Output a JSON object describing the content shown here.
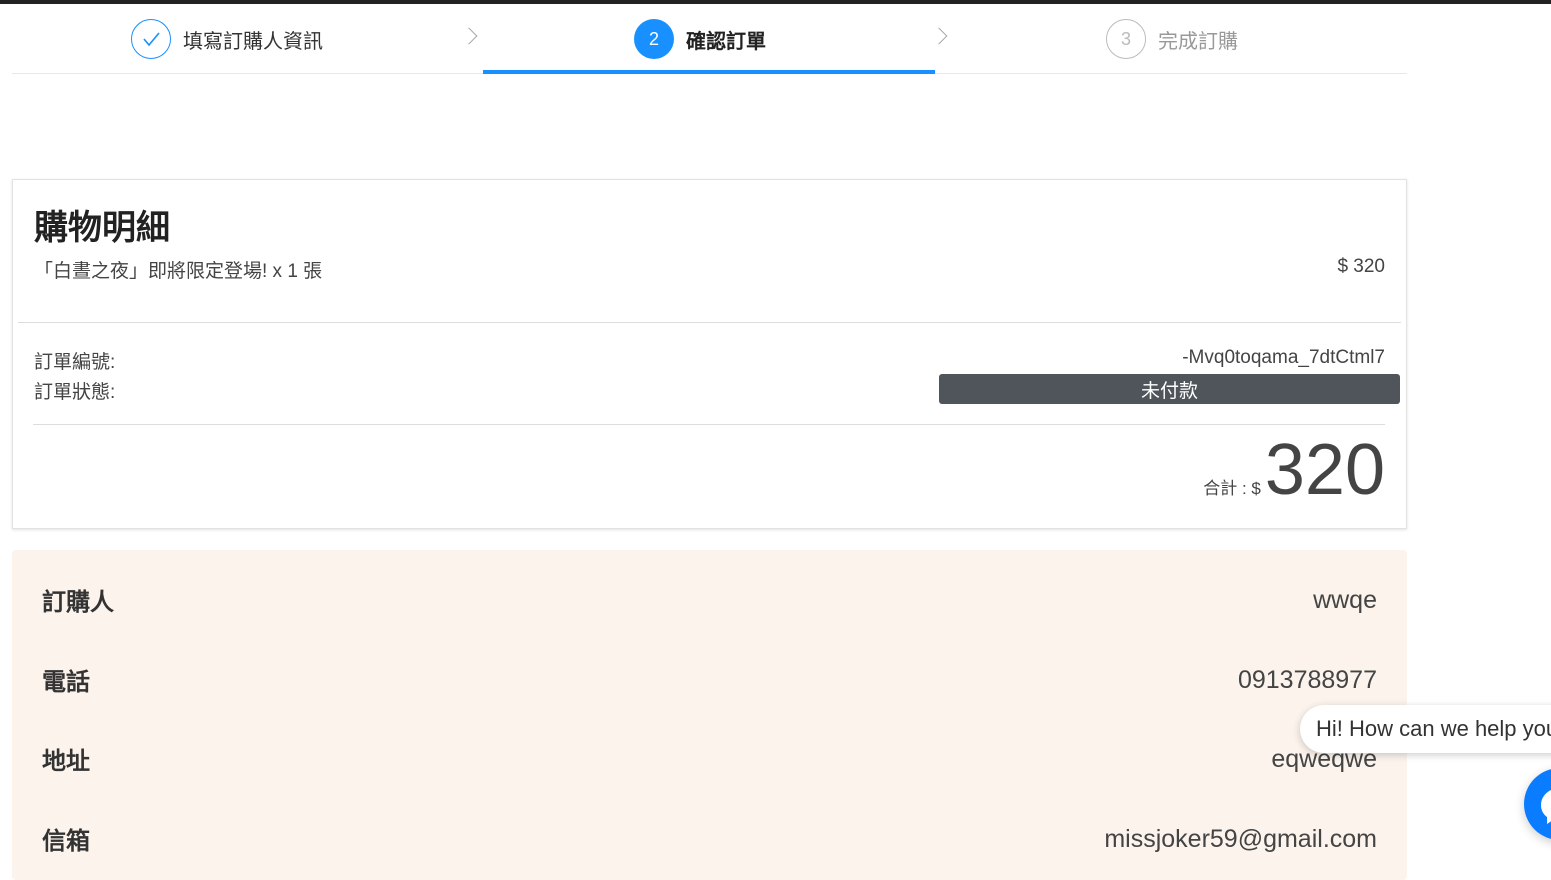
{
  "steps": [
    {
      "label": "填寫訂購人資訊",
      "state": "done",
      "icon": "check-icon"
    },
    {
      "number": "2",
      "label": "確認訂單",
      "state": "active"
    },
    {
      "number": "3",
      "label": "完成訂購",
      "state": "pending"
    }
  ],
  "order": {
    "title": "購物明細",
    "item_name": "「白晝之夜」即將限定登場!  x 1 張",
    "item_price": "$ 320",
    "order_no_label": "訂單編號:",
    "order_no_value": "-Mvq0toqama_7dtCtml7",
    "status_label": "訂單狀態:",
    "status_value": "未付款",
    "total_label": "合計 : $",
    "total_value": "320"
  },
  "buyer": [
    {
      "label": "訂購人",
      "value": "wwqe"
    },
    {
      "label": "電話",
      "value": "0913788977"
    },
    {
      "label": "地址",
      "value": "eqweqwe"
    },
    {
      "label": "信箱",
      "value": "missjoker59@gmail.com"
    }
  ],
  "chat": {
    "greeting": "Hi! How can we help you?",
    "icon": "messenger-icon"
  },
  "colors": {
    "accent": "#1890ff",
    "badge": "#50555c",
    "info_bg": "#fbf3ec",
    "messenger": "#0a7cff"
  }
}
